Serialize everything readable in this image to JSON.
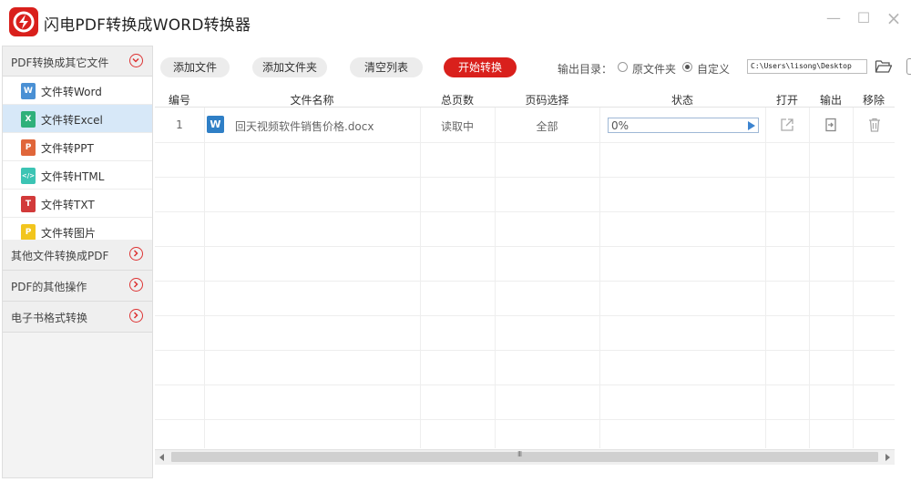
{
  "app": {
    "title": "闪电PDF转换成WORD转换器",
    "brand_color": "#d9201c",
    "window_controls": {
      "minimize": "—",
      "maximize": "☐",
      "close": "×"
    }
  },
  "sidebar": {
    "categories": [
      {
        "label": "PDF转换成其它文件",
        "expanded": true
      },
      {
        "label": "其他文件转换成PDF",
        "expanded": false
      },
      {
        "label": "PDF的其他操作",
        "expanded": false
      },
      {
        "label": "电子书格式转换",
        "expanded": false
      }
    ],
    "items": [
      {
        "label": "文件转Word",
        "icon": "word-file-icon",
        "glyph": "W",
        "color": "#4a90d4"
      },
      {
        "label": "文件转Excel",
        "icon": "excel-file-icon",
        "glyph": "X",
        "color": "#2fb07a",
        "active": true
      },
      {
        "label": "文件转PPT",
        "icon": "ppt-file-icon",
        "glyph": "P",
        "color": "#e0663a"
      },
      {
        "label": "文件转HTML",
        "icon": "html-file-icon",
        "glyph": "</>",
        "color": "#3cc4b4"
      },
      {
        "label": "文件转TXT",
        "icon": "txt-file-icon",
        "glyph": "T",
        "color": "#d23a3a"
      },
      {
        "label": "文件转图片",
        "icon": "image-file-icon",
        "glyph": "P",
        "color": "#f2c51d"
      }
    ]
  },
  "toolbar": {
    "add_file": "添加文件",
    "add_folder": "添加文件夹",
    "clear_list": "清空列表",
    "start": "开始转换",
    "output_label": "输出目录：",
    "option_original": "原文件夹",
    "option_custom": "自定义",
    "selected_option": "自定义",
    "path": "C:\\Users\\lisong\\Desktop"
  },
  "table": {
    "headers": [
      "编号",
      "文件名称",
      "总页数",
      "页码选择",
      "状态",
      "打开",
      "输出",
      "移除"
    ],
    "rows": [
      {
        "index": "1",
        "filename": "回天视频软件销售价格.docx",
        "pages": "读取中",
        "page_select": "全部",
        "status": "0%",
        "progress": 0
      }
    ]
  },
  "scrollbar": {
    "grip": "III"
  }
}
